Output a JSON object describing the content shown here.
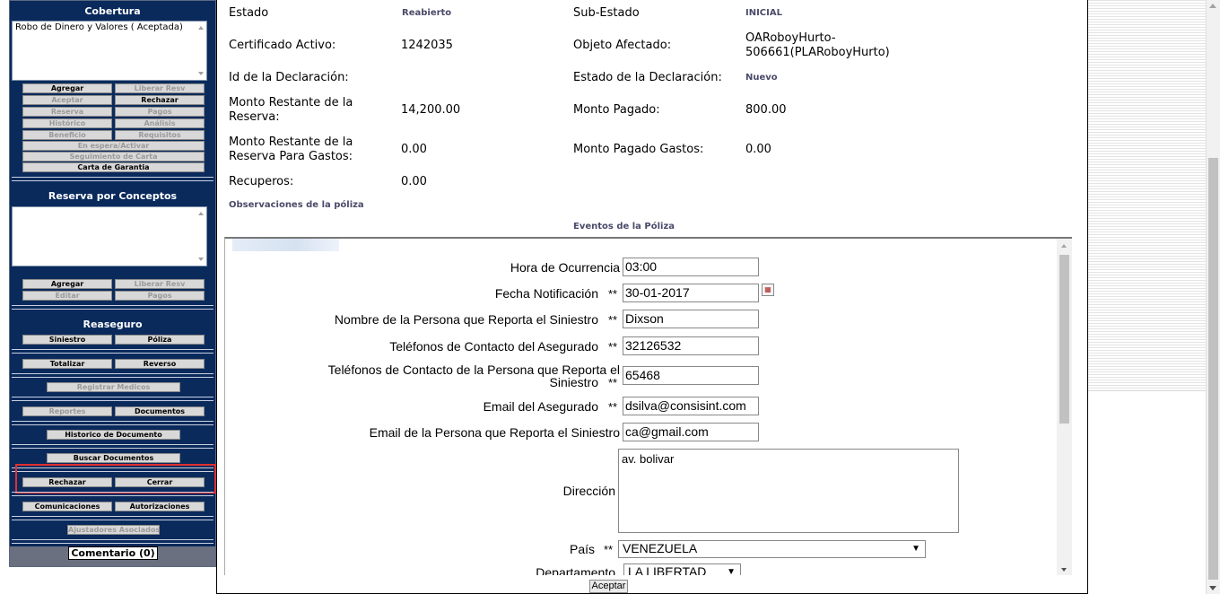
{
  "sidebar": {
    "cobertura": {
      "title": "Cobertura",
      "list_item": "Robo de Dinero y Valores ( Aceptada)",
      "buttons": {
        "agregar": "Agregar",
        "liberar_resv": "Liberar Resv",
        "aceptar": "Aceptar",
        "rechazar": "Rechazar",
        "reserva": "Reserva",
        "pagos": "Pagos",
        "historico": "Histórico",
        "analisis": "Análisis",
        "beneficio": "Beneficio",
        "requisitos": "Requisitos",
        "en_espera": "En espera/Activar",
        "seguimiento": "Seguimiento de Carta",
        "carta_garantia": "Carta de Garantia"
      }
    },
    "reserva_conceptos": {
      "title": "Reserva por Conceptos",
      "buttons": {
        "agregar": "Agregar",
        "liberar_resv": "Liberar Resv",
        "editar": "Editar",
        "pagos": "Pagos"
      }
    },
    "reaseguro": {
      "title": "Reaseguro",
      "buttons": {
        "siniestro": "Siniestro",
        "poliza": "Póliza",
        "totalizar": "Totalizar",
        "reverso": "Reverso",
        "registrar_medicos": "Registrar Medicos",
        "reportes": "Reportes",
        "documentos": "Documentos",
        "historico_documento": "Historico de Documento",
        "buscar_documentos": "Buscar Documentos",
        "rechazar": "Rechazar",
        "cerrar": "Cerrar",
        "comunicaciones": "Comunicaciones",
        "autorizaciones": "Autorizaciones",
        "ajustadores": "Ajustadores Asociados"
      }
    },
    "comentario": "Comentario (0)"
  },
  "details": {
    "estado_label": "Estado",
    "estado_value": "Reabierto",
    "subestado_label": "Sub-Estado",
    "subestado_value": "INICIAL",
    "certificado_label": "Certificado Activo:",
    "certificado_value": "1242035",
    "objeto_label": "Objeto Afectado:",
    "objeto_value_1": "OARoboyHurto-",
    "objeto_value_2": "506661(PLARoboyHurto)",
    "id_decl_label": "Id de la Declaración:",
    "estado_decl_label": "Estado de la Declaración:",
    "estado_decl_value": "Nuevo",
    "monto_restante_label_1": "Monto Restante de la",
    "monto_restante_label_2": "Reserva:",
    "monto_restante_value": "14,200.00",
    "monto_pagado_label": "Monto Pagado:",
    "monto_pagado_value": "800.00",
    "monto_gastos_label_1": "Monto Restante de la",
    "monto_gastos_label_2": "Reserva Para Gastos:",
    "monto_gastos_value": "0.00",
    "monto_pagado_gastos_label": "Monto Pagado Gastos:",
    "monto_pagado_gastos_value": "0.00",
    "recuperos_label": "Recuperos:",
    "recuperos_value": "0.00",
    "observaciones": "Observaciones de la póliza",
    "eventos": "Eventos de la Póliza"
  },
  "form": {
    "required_mark": "**",
    "hora_label": "Hora de Ocurrencia",
    "hora_value": "03:00",
    "fecha_label": "Fecha Notificación",
    "fecha_value": "30-01-2017",
    "nombre_label": "Nombre de la Persona que Reporta el Siniestro",
    "nombre_value": "Dixson",
    "tel_aseg_label": "Teléfonos de Contacto del Asegurado",
    "tel_aseg_value": "32126532",
    "tel_pers_label_1": "Teléfonos de Contacto de la Persona que Reporta el",
    "tel_pers_label_2": "Siniestro",
    "tel_pers_value": "65468",
    "email_aseg_label": "Email del Asegurado",
    "email_aseg_value": "dsilva@consisint.com",
    "email_pers_label": "Email de la Persona que Reporta el Siniestro",
    "email_pers_value": "ca@gmail.com",
    "direccion_label": "Dirección",
    "direccion_value": "av. bolivar",
    "pais_label": "País",
    "pais_value": "VENEZUELA",
    "depto_label": "Departamento",
    "depto_value": "LA LIBERTAD"
  },
  "footer": {
    "aceptar": "Aceptar"
  },
  "colors": {
    "sidebar_bg": "#0a2a5c",
    "highlight": "#e03030"
  }
}
